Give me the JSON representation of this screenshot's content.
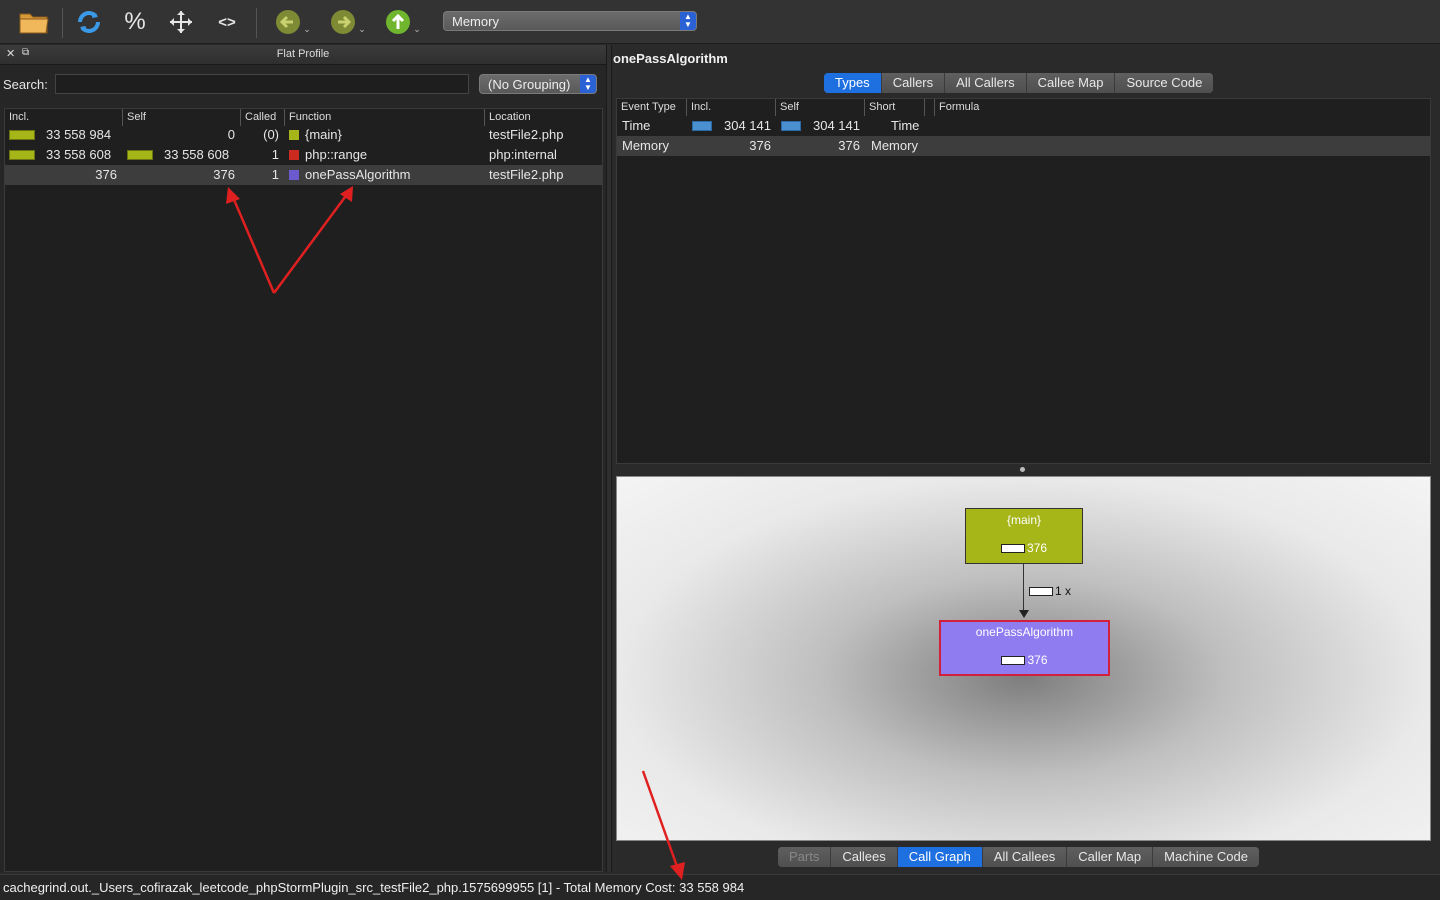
{
  "toolbar": {
    "event_type": "Memory",
    "percent_label": "%",
    "code_label": "<>"
  },
  "flat_profile": {
    "title": "Flat Profile",
    "search_label": "Search:",
    "search_value": "",
    "grouping": "(No Grouping)",
    "columns": [
      "Incl.",
      "Self",
      "Called",
      "Function",
      "Location"
    ],
    "rows": [
      {
        "incl": "33 558 984",
        "incl_bar": 1.0,
        "self": "0",
        "self_bar": 0,
        "called": "(0)",
        "function": "{main}",
        "color": "#a6b518",
        "location": "testFile2.php"
      },
      {
        "incl": "33 558 608",
        "incl_bar": 1.0,
        "self": "33 558 608",
        "self_bar": 1.0,
        "called": "1",
        "function": "php::range",
        "color": "#cc2a1e",
        "location": "php:internal"
      },
      {
        "incl": "376",
        "incl_bar": 0,
        "self": "376",
        "self_bar": 0,
        "called": "1",
        "function": "onePassAlgorithm",
        "color": "#6a5acd",
        "location": "testFile2.php"
      }
    ]
  },
  "detail": {
    "function_name": "onePassAlgorithm",
    "top_tabs": [
      "Types",
      "Callers",
      "All Callers",
      "Callee Map",
      "Source Code"
    ],
    "top_active": "Types",
    "types_columns": [
      "Event Type",
      "Incl.",
      "Self",
      "Short",
      "Formula"
    ],
    "types_rows": [
      {
        "event": "Time",
        "incl": "304 141",
        "self": "304 141",
        "short": "Time",
        "formula": ""
      },
      {
        "event": "Memory",
        "incl": "376",
        "self": "376",
        "short": "Memory",
        "formula": ""
      }
    ],
    "graph": {
      "caller": {
        "name": "{main}",
        "cost": "376",
        "color": "#a6b518"
      },
      "callee": {
        "name": "onePassAlgorithm",
        "cost": "376",
        "color": "#8e7cf0"
      },
      "edge": {
        "cost": "1 x"
      }
    },
    "bottom_tabs": [
      "Parts",
      "Callees",
      "Call Graph",
      "All Callees",
      "Caller Map",
      "Machine Code"
    ],
    "bottom_active": "Call Graph"
  },
  "status": "cachegrind.out._Users_cofirazak_leetcode_phpStormPlugin_src_testFile2_php.1575699955 [1] - Total Memory Cost: 33 558 984",
  "annotations": {
    "arrow_color": "#e02020"
  }
}
